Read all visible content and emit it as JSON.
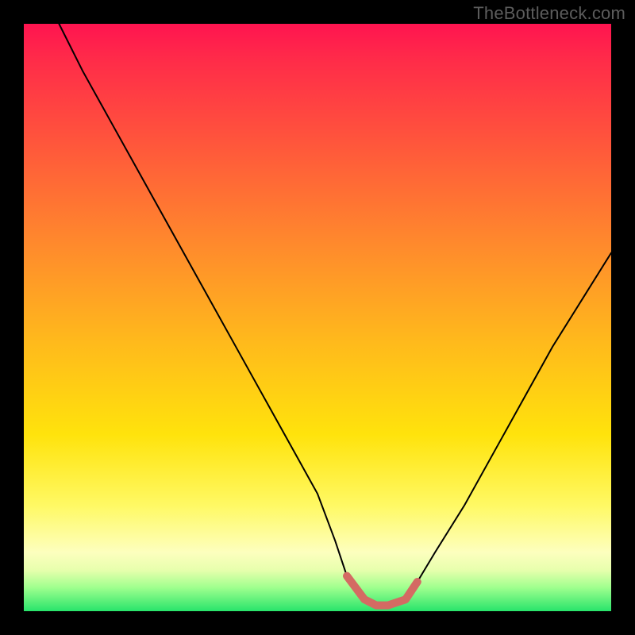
{
  "watermark": "TheBottleneck.com",
  "chart_data": {
    "type": "line",
    "title": "",
    "xlabel": "",
    "ylabel": "",
    "xlim": [
      0,
      100
    ],
    "ylim": [
      0,
      100
    ],
    "series": [
      {
        "name": "bottleneck-curve",
        "x": [
          6,
          10,
          15,
          20,
          25,
          30,
          35,
          40,
          45,
          50,
          53,
          55,
          58,
          60,
          62,
          65,
          67,
          70,
          75,
          80,
          85,
          90,
          95,
          100
        ],
        "y": [
          100,
          92,
          83,
          74,
          65,
          56,
          47,
          38,
          29,
          20,
          12,
          6,
          2,
          1,
          1,
          2,
          5,
          10,
          18,
          27,
          36,
          45,
          53,
          61
        ]
      }
    ],
    "highlight_trough": {
      "name": "trough-marker",
      "x": [
        55,
        58,
        60,
        62,
        65,
        67
      ],
      "y": [
        6,
        2,
        1,
        1,
        2,
        5
      ]
    },
    "background_gradient": {
      "top": "#ff1450",
      "mid": "#ffe30c",
      "bottom": "#28e46b"
    }
  }
}
